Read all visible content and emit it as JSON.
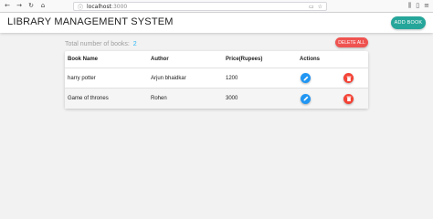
{
  "browser": {
    "url_host": "localhost",
    "url_port": ":3000"
  },
  "app": {
    "title": "LIBRARY MANAGEMENT SYSTEM",
    "add_button": "ADD BOOK"
  },
  "summary": {
    "label": "Total number of books:",
    "count": "2",
    "delete_all": "DELETE ALL"
  },
  "table": {
    "headers": [
      "Book Name",
      "Author",
      "Price(Rupees)",
      "Actions"
    ],
    "rows": [
      {
        "name": "harry potter",
        "author": "Arjun bhaidkar",
        "price": "1200"
      },
      {
        "name": "Game of thrones",
        "author": "Rohen",
        "price": "3000"
      }
    ]
  },
  "colors": {
    "add_button": "#26a69a",
    "delete_all": "#ef5350",
    "edit": "#2196f3",
    "delete": "#f44336",
    "count": "#29b6f6"
  },
  "icons": {
    "edit": "pencil-icon",
    "delete": "trash-icon"
  }
}
